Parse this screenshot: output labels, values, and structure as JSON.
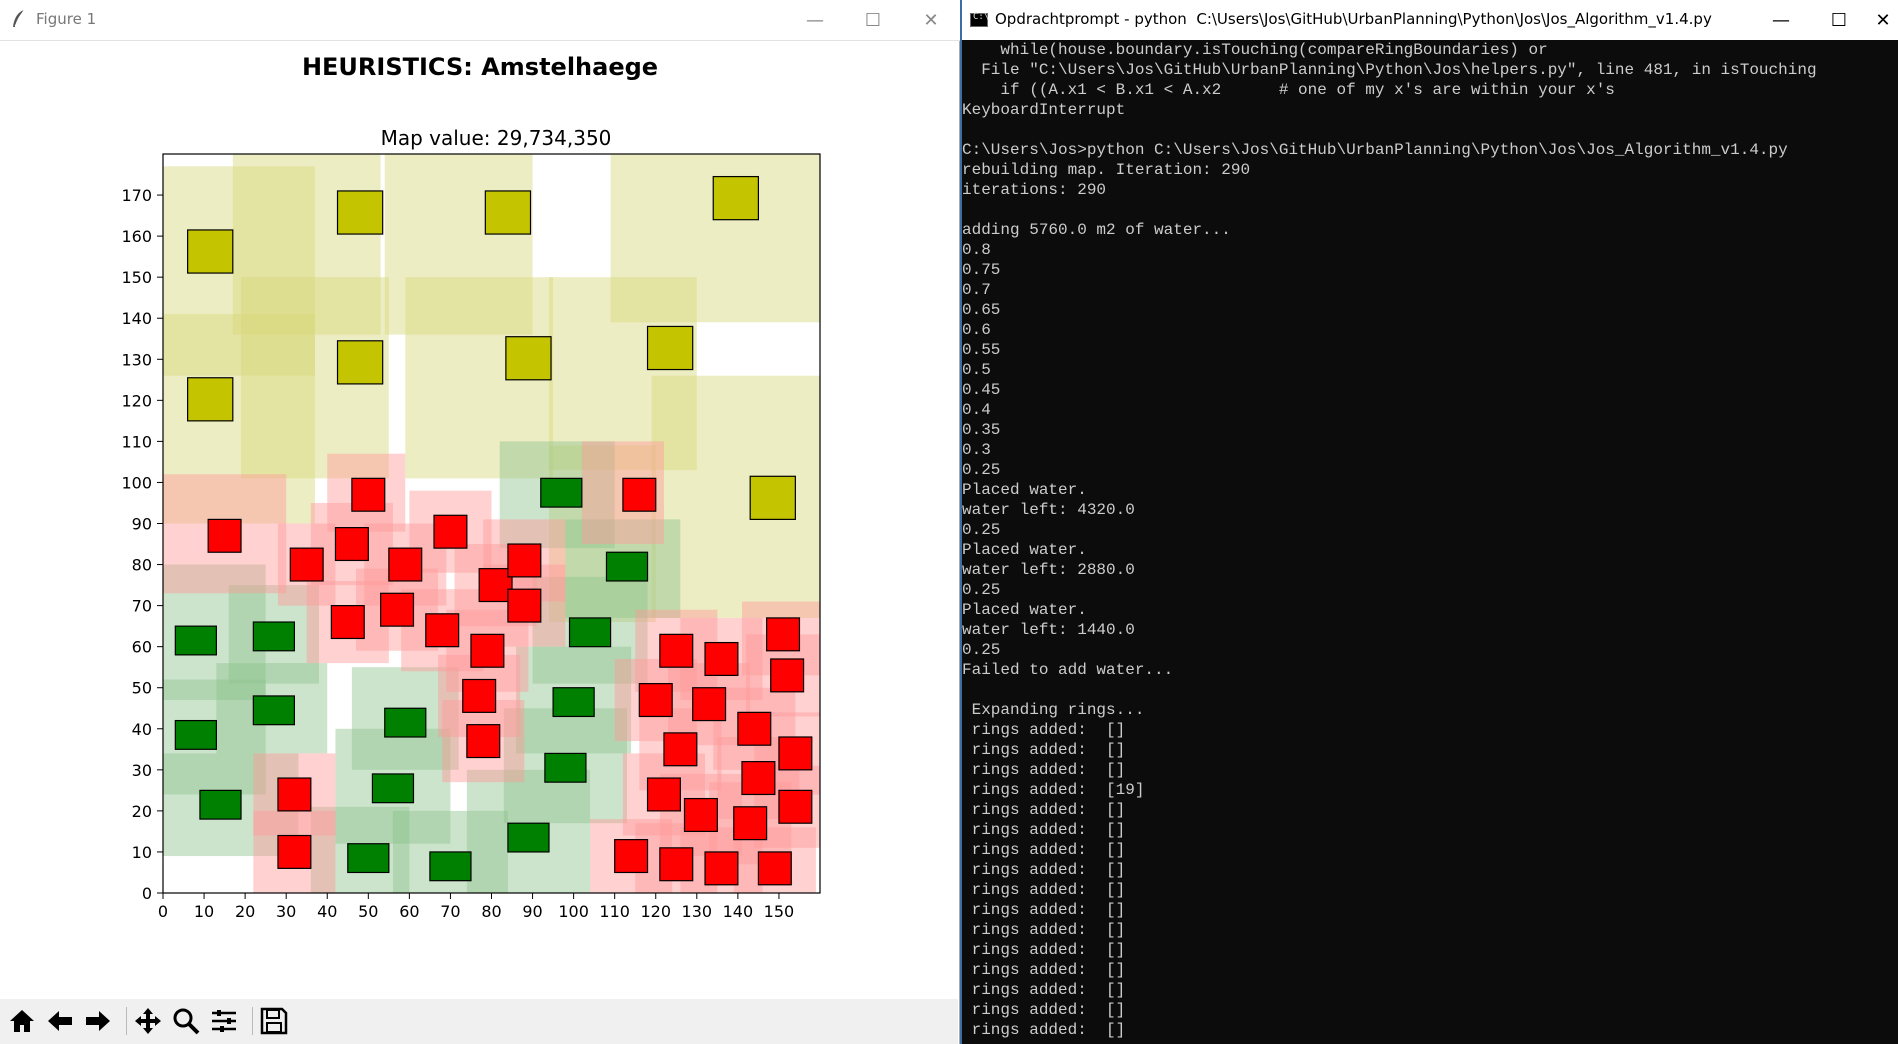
{
  "figure_window": {
    "title": "Figure 1",
    "minimize_glyph": "—",
    "maximize_glyph": "☐",
    "close_glyph": "✕",
    "icon": "feather-icon"
  },
  "chart_data": {
    "type": "map",
    "title": "HEURISTICS: Amstelhaege",
    "subtitle": "Map value: 29,734,350",
    "xlim": [
      0,
      160
    ],
    "ylim": [
      0,
      180
    ],
    "x_ticks": [
      0,
      10,
      20,
      30,
      40,
      50,
      60,
      70,
      80,
      90,
      100,
      110,
      120,
      130,
      140,
      150
    ],
    "y_ticks": [
      0,
      10,
      20,
      30,
      40,
      50,
      60,
      70,
      80,
      90,
      100,
      110,
      120,
      130,
      140,
      150,
      160,
      170
    ],
    "grid": false,
    "colors": {
      "maison": "#c4c400",
      "maison_ring": "#d6d67a",
      "bungalow": "#008000",
      "bungalow_ring": "#8fc48f",
      "familyhome": "#ff0000",
      "familyhome_ring": "#ff9a9a",
      "outline": "#000000"
    },
    "houses": [
      {
        "type": "maison",
        "x": 6,
        "y": 151,
        "w": 11,
        "h": 10.5,
        "ring": [
          0,
          126,
          37,
          51
        ]
      },
      {
        "type": "maison",
        "x": 42.5,
        "y": 160.5,
        "w": 11,
        "h": 10.5,
        "ring": [
          17,
          136,
          36,
          44
        ]
      },
      {
        "type": "maison",
        "x": 78.5,
        "y": 160.5,
        "w": 11,
        "h": 10.5,
        "ring": [
          54,
          136,
          36,
          44
        ]
      },
      {
        "type": "maison",
        "x": 134,
        "y": 164,
        "w": 11,
        "h": 10.5,
        "ring": [
          109,
          139,
          51,
          41
        ]
      },
      {
        "type": "maison",
        "x": 6,
        "y": 115,
        "w": 11,
        "h": 10.5,
        "ring": [
          0,
          90,
          37,
          51
        ]
      },
      {
        "type": "maison",
        "x": 42.5,
        "y": 124,
        "w": 11,
        "h": 10.5,
        "ring": [
          19,
          101,
          36,
          49
        ]
      },
      {
        "type": "maison",
        "x": 83.5,
        "y": 125,
        "w": 11,
        "h": 10.5,
        "ring": [
          59,
          101,
          36,
          49
        ]
      },
      {
        "type": "maison",
        "x": 118,
        "y": 127.5,
        "w": 11,
        "h": 10.5,
        "ring": [
          94,
          103,
          36,
          47
        ]
      },
      {
        "type": "maison",
        "x": 143,
        "y": 91,
        "w": 11,
        "h": 10.5,
        "ring": [
          119,
          67,
          41,
          59
        ]
      },
      {
        "type": "maison",
        "x": 0,
        "y": 0,
        "w": 0,
        "h": 0,
        "ring": [
          94,
          66,
          26,
          43
        ]
      },
      {
        "type": "bungalow",
        "x": 3,
        "y": 58,
        "w": 10,
        "h": 7,
        "ring": [
          0,
          47,
          25,
          33
        ]
      },
      {
        "type": "bungalow",
        "x": 22,
        "y": 59,
        "w": 10,
        "h": 7,
        "ring": [
          16,
          51,
          22,
          24
        ]
      },
      {
        "type": "bungalow",
        "x": 22,
        "y": 41,
        "w": 10,
        "h": 7,
        "ring": [
          13,
          34,
          27,
          22
        ]
      },
      {
        "type": "bungalow",
        "x": 3,
        "y": 35,
        "w": 10,
        "h": 7,
        "ring": [
          0,
          24,
          25,
          28
        ]
      },
      {
        "type": "bungalow",
        "x": 9,
        "y": 18,
        "w": 10,
        "h": 7,
        "ring": [
          0,
          9,
          33,
          25
        ]
      },
      {
        "type": "bungalow",
        "x": 54,
        "y": 38,
        "w": 10,
        "h": 7,
        "ring": [
          46,
          30,
          26,
          25
        ]
      },
      {
        "type": "bungalow",
        "x": 51,
        "y": 22,
        "w": 10,
        "h": 7,
        "ring": [
          42,
          12,
          28,
          28
        ]
      },
      {
        "type": "bungalow",
        "x": 45,
        "y": 5,
        "w": 10,
        "h": 7,
        "ring": [
          36,
          0,
          24,
          21
        ]
      },
      {
        "type": "bungalow",
        "x": 65,
        "y": 3,
        "w": 10,
        "h": 7,
        "ring": [
          56,
          0,
          28,
          20
        ]
      },
      {
        "type": "bungalow",
        "x": 84,
        "y": 10,
        "w": 10,
        "h": 7,
        "ring": [
          74,
          0,
          30,
          30
        ]
      },
      {
        "type": "bungalow",
        "x": 93,
        "y": 27,
        "w": 10,
        "h": 7,
        "ring": [
          83,
          17,
          30,
          28
        ]
      },
      {
        "type": "bungalow",
        "x": 95,
        "y": 43,
        "w": 10,
        "h": 7,
        "ring": [
          86,
          34,
          28,
          26
        ]
      },
      {
        "type": "bungalow",
        "x": 99,
        "y": 60,
        "w": 10,
        "h": 7,
        "ring": [
          90,
          51,
          28,
          26
        ]
      },
      {
        "type": "bungalow",
        "x": 108,
        "y": 76,
        "w": 10,
        "h": 7,
        "ring": [
          98,
          67,
          28,
          24
        ]
      },
      {
        "type": "bungalow",
        "x": 92,
        "y": 94,
        "w": 10,
        "h": 7,
        "ring": [
          82,
          84,
          28,
          26
        ]
      },
      {
        "type": "familyhome",
        "x": 11,
        "y": 83,
        "w": 8,
        "h": 8,
        "ring": [
          0,
          73,
          30,
          29
        ]
      },
      {
        "type": "familyhome",
        "x": 31,
        "y": 76,
        "w": 8,
        "h": 8,
        "ring": [
          28,
          70,
          14,
          20
        ]
      },
      {
        "type": "familyhome",
        "x": 46,
        "y": 93,
        "w": 8,
        "h": 8,
        "ring": [
          40,
          88,
          19,
          19
        ]
      },
      {
        "type": "familyhome",
        "x": 42,
        "y": 81,
        "w": 8,
        "h": 8,
        "ring": [
          36,
          75,
          20,
          20
        ]
      },
      {
        "type": "familyhome",
        "x": 55,
        "y": 76,
        "w": 8,
        "h": 8,
        "ring": [
          49,
          70,
          20,
          20
        ]
      },
      {
        "type": "familyhome",
        "x": 66,
        "y": 84,
        "w": 8,
        "h": 8,
        "ring": [
          60,
          78,
          20,
          20
        ]
      },
      {
        "type": "familyhome",
        "x": 77,
        "y": 71,
        "w": 8,
        "h": 8,
        "ring": [
          71,
          65,
          20,
          20
        ]
      },
      {
        "type": "familyhome",
        "x": 84,
        "y": 77,
        "w": 8,
        "h": 8,
        "ring": [
          78,
          71,
          20,
          20
        ]
      },
      {
        "type": "familyhome",
        "x": 84,
        "y": 66,
        "w": 8,
        "h": 8,
        "ring": [
          78,
          60,
          20,
          20
        ]
      },
      {
        "type": "familyhome",
        "x": 41,
        "y": 62,
        "w": 8,
        "h": 8,
        "ring": [
          35,
          56,
          20,
          20
        ]
      },
      {
        "type": "familyhome",
        "x": 53,
        "y": 65,
        "w": 8,
        "h": 8,
        "ring": [
          47,
          59,
          20,
          20
        ]
      },
      {
        "type": "familyhome",
        "x": 64,
        "y": 60,
        "w": 8,
        "h": 8,
        "ring": [
          58,
          54,
          20,
          20
        ]
      },
      {
        "type": "familyhome",
        "x": 75,
        "y": 55,
        "w": 8,
        "h": 8,
        "ring": [
          69,
          49,
          20,
          20
        ]
      },
      {
        "type": "familyhome",
        "x": 73,
        "y": 44,
        "w": 8,
        "h": 8,
        "ring": [
          67,
          38,
          20,
          20
        ]
      },
      {
        "type": "familyhome",
        "x": 74,
        "y": 33,
        "w": 8,
        "h": 8,
        "ring": [
          68,
          27,
          20,
          20
        ]
      },
      {
        "type": "familyhome",
        "x": 112,
        "y": 93,
        "w": 8,
        "h": 8,
        "ring": [
          102,
          85,
          20,
          25
        ]
      },
      {
        "type": "familyhome",
        "x": 28,
        "y": 20,
        "w": 8,
        "h": 8,
        "ring": [
          22,
          14,
          20,
          20
        ]
      },
      {
        "type": "familyhome",
        "x": 28,
        "y": 6,
        "w": 8,
        "h": 8,
        "ring": [
          22,
          0,
          20,
          20
        ]
      },
      {
        "type": "familyhome",
        "x": 116,
        "y": 43,
        "w": 8,
        "h": 8,
        "ring": [
          110,
          37,
          20,
          20
        ]
      },
      {
        "type": "familyhome",
        "x": 121,
        "y": 55,
        "w": 8,
        "h": 8,
        "ring": [
          115,
          49,
          20,
          20
        ]
      },
      {
        "type": "familyhome",
        "x": 129,
        "y": 42,
        "w": 8,
        "h": 8,
        "ring": [
          123,
          36,
          20,
          20
        ]
      },
      {
        "type": "familyhome",
        "x": 132,
        "y": 53,
        "w": 8,
        "h": 8,
        "ring": [
          126,
          47,
          20,
          20
        ]
      },
      {
        "type": "familyhome",
        "x": 122,
        "y": 31,
        "w": 8,
        "h": 8,
        "ring": [
          116,
          25,
          20,
          20
        ]
      },
      {
        "type": "familyhome",
        "x": 118,
        "y": 20,
        "w": 8,
        "h": 8,
        "ring": [
          112,
          14,
          20,
          20
        ]
      },
      {
        "type": "familyhome",
        "x": 127,
        "y": 15,
        "w": 8,
        "h": 8,
        "ring": [
          121,
          9,
          20,
          20
        ]
      },
      {
        "type": "familyhome",
        "x": 110,
        "y": 5,
        "w": 8,
        "h": 8,
        "ring": [
          104,
          0,
          20,
          18
        ]
      },
      {
        "type": "familyhome",
        "x": 121,
        "y": 3,
        "w": 8,
        "h": 8,
        "ring": [
          115,
          0,
          20,
          17
        ]
      },
      {
        "type": "familyhome",
        "x": 132,
        "y": 2,
        "w": 8,
        "h": 8,
        "ring": [
          126,
          0,
          20,
          16
        ]
      },
      {
        "type": "familyhome",
        "x": 145,
        "y": 2,
        "w": 8,
        "h": 8,
        "ring": [
          139,
          0,
          20,
          16
        ]
      },
      {
        "type": "familyhome",
        "x": 139,
        "y": 13,
        "w": 8,
        "h": 8,
        "ring": [
          133,
          7,
          20,
          20
        ]
      },
      {
        "type": "familyhome",
        "x": 141,
        "y": 24,
        "w": 8,
        "h": 8,
        "ring": [
          135,
          18,
          20,
          20
        ]
      },
      {
        "type": "familyhome",
        "x": 140,
        "y": 36,
        "w": 8,
        "h": 8,
        "ring": [
          134,
          30,
          20,
          20
        ]
      },
      {
        "type": "familyhome",
        "x": 150,
        "y": 17,
        "w": 8,
        "h": 8,
        "ring": [
          144,
          11,
          16,
          20
        ]
      },
      {
        "type": "familyhome",
        "x": 150,
        "y": 30,
        "w": 8,
        "h": 8,
        "ring": [
          144,
          24,
          16,
          20
        ]
      },
      {
        "type": "familyhome",
        "x": 148,
        "y": 49,
        "w": 8,
        "h": 8,
        "ring": [
          142,
          43,
          18,
          20
        ]
      },
      {
        "type": "familyhome",
        "x": 147,
        "y": 59,
        "w": 8,
        "h": 8,
        "ring": [
          141,
          53,
          19,
          18
        ]
      }
    ]
  },
  "toolbar": {
    "buttons": [
      "home-icon",
      "back-arrow-icon",
      "forward-arrow-icon",
      "pan-icon",
      "zoom-icon",
      "configure-subplots-icon",
      "save-icon"
    ]
  },
  "console_window": {
    "title": "Opdrachtprompt - python  C:\\Users\\Jos\\GitHub\\UrbanPlanning\\Python\\Jos\\Jos_Algorithm_v1.4.py",
    "minimize_glyph": "—",
    "maximize_glyph": "☐",
    "close_glyph": "✕",
    "lines": [
      "    while(house.boundary.isTouching(compareRingBoundaries) or",
      "  File \"C:\\Users\\Jos\\GitHub\\UrbanPlanning\\Python\\Jos\\helpers.py\", line 481, in isTouching",
      "    if ((A.x1 < B.x1 < A.x2      # one of my x's are within your x's",
      "KeyboardInterrupt",
      "",
      "C:\\Users\\Jos>python C:\\Users\\Jos\\GitHub\\UrbanPlanning\\Python\\Jos\\Jos_Algorithm_v1.4.py",
      "rebuilding map. Iteration: 290",
      "iterations: 290",
      "",
      "adding 5760.0 m2 of water...",
      "0.8",
      "0.75",
      "0.7",
      "0.65",
      "0.6",
      "0.55",
      "0.5",
      "0.45",
      "0.4",
      "0.35",
      "0.3",
      "0.25",
      "Placed water.",
      "water left: 4320.0",
      "0.25",
      "Placed water.",
      "water left: 2880.0",
      "0.25",
      "Placed water.",
      "water left: 1440.0",
      "0.25",
      "Failed to add water...",
      "",
      " Expanding rings...",
      " rings added:  []",
      " rings added:  []",
      " rings added:  []",
      " rings added:  [19]",
      " rings added:  []",
      " rings added:  []",
      " rings added:  []",
      " rings added:  []",
      " rings added:  []",
      " rings added:  []",
      " rings added:  []",
      " rings added:  []",
      " rings added:  []",
      " rings added:  []",
      " rings added:  []",
      " rings added:  []"
    ]
  }
}
